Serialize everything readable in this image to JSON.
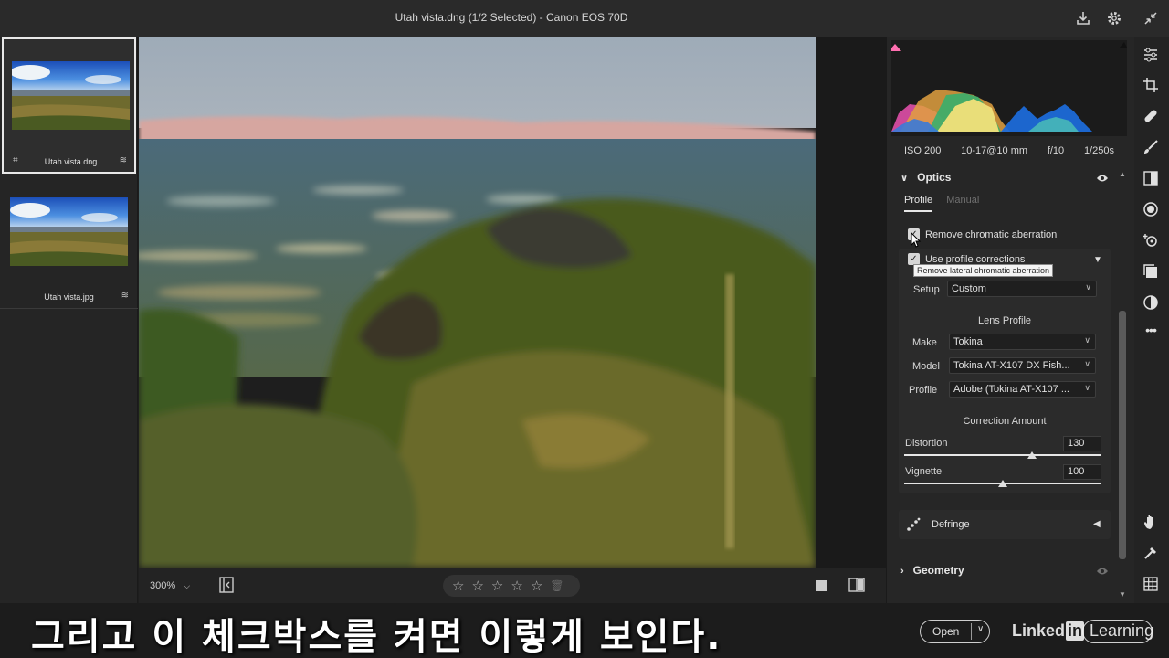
{
  "window": {
    "title": "Utah vista.dng (1/2 Selected)  -  Canon EOS 70D"
  },
  "filmstrip": {
    "items": [
      {
        "label": "Utah vista.dng",
        "selected": true
      },
      {
        "label": "Utah vista.jpg",
        "selected": false
      }
    ]
  },
  "viewer": {
    "zoom": "300%",
    "rating_stars": 0
  },
  "histogram": {
    "exif": [
      "ISO 200",
      "10-17@10 mm",
      "f/10",
      "1/250s"
    ]
  },
  "optics": {
    "title": "Optics",
    "tabs": [
      "Profile",
      "Manual"
    ],
    "active_tab": "Profile",
    "remove_ca_label": "Remove chromatic aberration",
    "remove_ca_checked": true,
    "use_profile_label": "Use profile corrections",
    "use_profile_checked": true,
    "tooltip": "Remove lateral chromatic aberration",
    "setup_label": "Setup",
    "setup_value": "Custom",
    "lens_profile_heading": "Lens Profile",
    "make_label": "Make",
    "make_value": "Tokina",
    "model_label": "Model",
    "model_value": "Tokina AT-X107 DX Fish...",
    "profile_label": "Profile",
    "profile_value": "Adobe (Tokina AT-X107 ...",
    "correction_heading": "Correction Amount",
    "distortion_label": "Distortion",
    "distortion_value": "130",
    "distortion_fraction": 0.65,
    "vignette_label": "Vignette",
    "vignette_value": "100",
    "vignette_fraction": 0.5,
    "defringe_label": "Defringe"
  },
  "geometry": {
    "title": "Geometry"
  },
  "footer": {
    "caption": "그리고 이 체크박스를 켜면 이렇게 보인다.",
    "open_label": "Open"
  },
  "brand": {
    "prefix": "Linked",
    "in": "in",
    "suffix": " Learning"
  },
  "colors": {
    "accent_text": "#e6e6e6",
    "panel_bg": "#262626"
  }
}
